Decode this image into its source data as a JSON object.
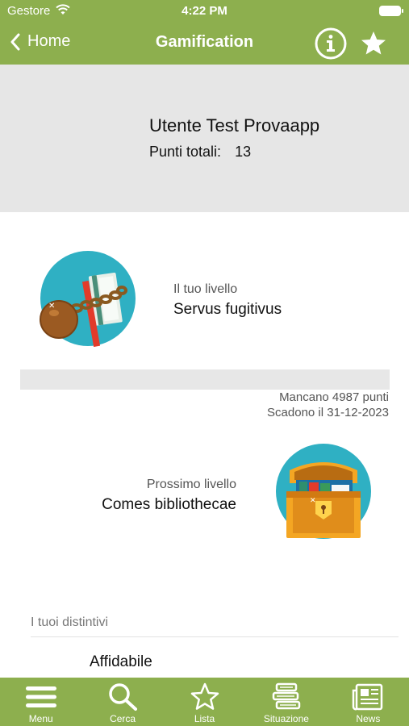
{
  "status_bar": {
    "carrier": "Gestore",
    "time": "4:22 PM"
  },
  "nav": {
    "back_label": "Home",
    "title": "Gamification"
  },
  "profile": {
    "name": "Utente Test Provaapp",
    "points_label": "Punti totali:",
    "points_value": "13"
  },
  "current_level": {
    "label": "Il tuo livello",
    "value": "Servus fugitivus"
  },
  "progress": {
    "fraction": 0.0,
    "missing_text": "Mancano 4987 punti",
    "expire_text": "Scadono il 31-12-2023"
  },
  "next_level": {
    "label": "Prossimo livello",
    "value": "Comes bibliothecae"
  },
  "badges": {
    "title": "I tuoi distintivi",
    "items": [
      "Affidabile"
    ]
  },
  "tabbar": {
    "tabs": [
      {
        "label": "Menu",
        "icon": "menu-icon"
      },
      {
        "label": "Cerca",
        "icon": "search-icon"
      },
      {
        "label": "Lista",
        "icon": "star-outline-icon"
      },
      {
        "label": "Situazione",
        "icon": "books-stack-icon"
      },
      {
        "label": "News",
        "icon": "newspaper-icon"
      }
    ]
  },
  "colors": {
    "brand": "#8daf4e",
    "panel": "#e6e6e6",
    "icon_bg": "#2fb0c3"
  }
}
